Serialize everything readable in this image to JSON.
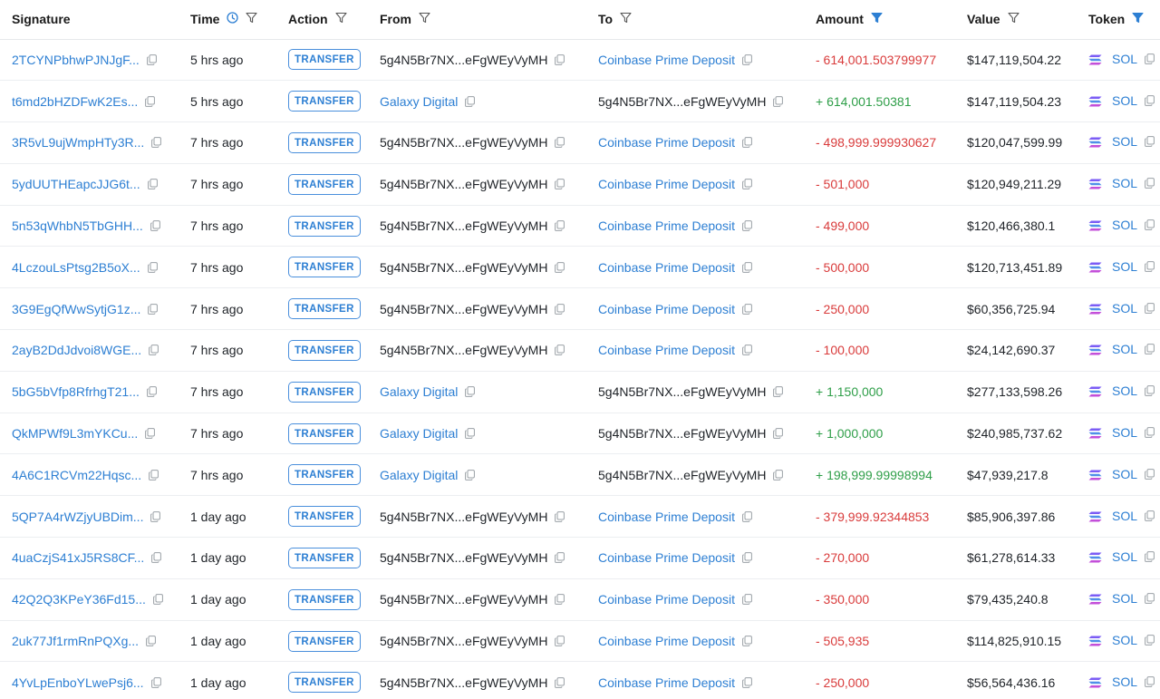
{
  "header": {
    "signature": "Signature",
    "time": "Time",
    "action": "Action",
    "from": "From",
    "to": "To",
    "amount": "Amount",
    "value": "Value",
    "token": "Token"
  },
  "colors": {
    "link": "#2d7fd3",
    "negative": "#d93b3b",
    "positive": "#2e9e48",
    "filter_active": "#2d7fd3"
  },
  "rows": [
    {
      "signature": "2TCYNPbhwPJNJgF...",
      "time": "5 hrs ago",
      "action": "TRANSFER",
      "from": "5g4N5Br7NX...eFgWEyVyMH",
      "to": "Coinbase Prime Deposit",
      "amount": "- 614,001.503799977",
      "value": "$147,119,504.22",
      "token": "SOL"
    },
    {
      "signature": "t6md2bHZDFwK2Es...",
      "time": "5 hrs ago",
      "action": "TRANSFER",
      "from": "Galaxy Digital",
      "to": "5g4N5Br7NX...eFgWEyVyMH",
      "amount": "+ 614,001.50381",
      "value": "$147,119,504.23",
      "token": "SOL"
    },
    {
      "signature": "3R5vL9ujWmpHTy3R...",
      "time": "7 hrs ago",
      "action": "TRANSFER",
      "from": "5g4N5Br7NX...eFgWEyVyMH",
      "to": "Coinbase Prime Deposit",
      "amount": "- 498,999.999930627",
      "value": "$120,047,599.99",
      "token": "SOL"
    },
    {
      "signature": "5ydUUTHEapcJJG6t...",
      "time": "7 hrs ago",
      "action": "TRANSFER",
      "from": "5g4N5Br7NX...eFgWEyVyMH",
      "to": "Coinbase Prime Deposit",
      "amount": "- 501,000",
      "value": "$120,949,211.29",
      "token": "SOL"
    },
    {
      "signature": "5n53qWhbN5TbGHH...",
      "time": "7 hrs ago",
      "action": "TRANSFER",
      "from": "5g4N5Br7NX...eFgWEyVyMH",
      "to": "Coinbase Prime Deposit",
      "amount": "- 499,000",
      "value": "$120,466,380.1",
      "token": "SOL"
    },
    {
      "signature": "4LczouLsPtsg2B5oX...",
      "time": "7 hrs ago",
      "action": "TRANSFER",
      "from": "5g4N5Br7NX...eFgWEyVyMH",
      "to": "Coinbase Prime Deposit",
      "amount": "- 500,000",
      "value": "$120,713,451.89",
      "token": "SOL"
    },
    {
      "signature": "3G9EgQfWwSytjG1z...",
      "time": "7 hrs ago",
      "action": "TRANSFER",
      "from": "5g4N5Br7NX...eFgWEyVyMH",
      "to": "Coinbase Prime Deposit",
      "amount": "- 250,000",
      "value": "$60,356,725.94",
      "token": "SOL"
    },
    {
      "signature": "2ayB2DdJdvoi8WGE...",
      "time": "7 hrs ago",
      "action": "TRANSFER",
      "from": "5g4N5Br7NX...eFgWEyVyMH",
      "to": "Coinbase Prime Deposit",
      "amount": "- 100,000",
      "value": "$24,142,690.37",
      "token": "SOL"
    },
    {
      "signature": "5bG5bVfp8RfrhgT21...",
      "time": "7 hrs ago",
      "action": "TRANSFER",
      "from": "Galaxy Digital",
      "to": "5g4N5Br7NX...eFgWEyVyMH",
      "amount": "+ 1,150,000",
      "value": "$277,133,598.26",
      "token": "SOL"
    },
    {
      "signature": "QkMPWf9L3mYKCu...",
      "time": "7 hrs ago",
      "action": "TRANSFER",
      "from": "Galaxy Digital",
      "to": "5g4N5Br7NX...eFgWEyVyMH",
      "amount": "+ 1,000,000",
      "value": "$240,985,737.62",
      "token": "SOL"
    },
    {
      "signature": "4A6C1RCVm22Hqsc...",
      "time": "7 hrs ago",
      "action": "TRANSFER",
      "from": "Galaxy Digital",
      "to": "5g4N5Br7NX...eFgWEyVyMH",
      "amount": "+ 198,999.99998994",
      "value": "$47,939,217.8",
      "token": "SOL"
    },
    {
      "signature": "5QP7A4rWZjyUBDim...",
      "time": "1 day ago",
      "action": "TRANSFER",
      "from": "5g4N5Br7NX...eFgWEyVyMH",
      "to": "Coinbase Prime Deposit",
      "amount": "- 379,999.92344853",
      "value": "$85,906,397.86",
      "token": "SOL"
    },
    {
      "signature": "4uaCzjS41xJ5RS8CF...",
      "time": "1 day ago",
      "action": "TRANSFER",
      "from": "5g4N5Br7NX...eFgWEyVyMH",
      "to": "Coinbase Prime Deposit",
      "amount": "- 270,000",
      "value": "$61,278,614.33",
      "token": "SOL"
    },
    {
      "signature": "42Q2Q3KPeY36Fd15...",
      "time": "1 day ago",
      "action": "TRANSFER",
      "from": "5g4N5Br7NX...eFgWEyVyMH",
      "to": "Coinbase Prime Deposit",
      "amount": "- 350,000",
      "value": "$79,435,240.8",
      "token": "SOL"
    },
    {
      "signature": "2uk77Jf1rmRnPQXg...",
      "time": "1 day ago",
      "action": "TRANSFER",
      "from": "5g4N5Br7NX...eFgWEyVyMH",
      "to": "Coinbase Prime Deposit",
      "amount": "- 505,935",
      "value": "$114,825,910.15",
      "token": "SOL"
    },
    {
      "signature": "4YvLpEnboYLwePsj6...",
      "time": "1 day ago",
      "action": "TRANSFER",
      "from": "5g4N5Br7NX...eFgWEyVyMH",
      "to": "Coinbase Prime Deposit",
      "amount": "- 250,000",
      "value": "$56,564,436.16",
      "token": "SOL"
    }
  ]
}
